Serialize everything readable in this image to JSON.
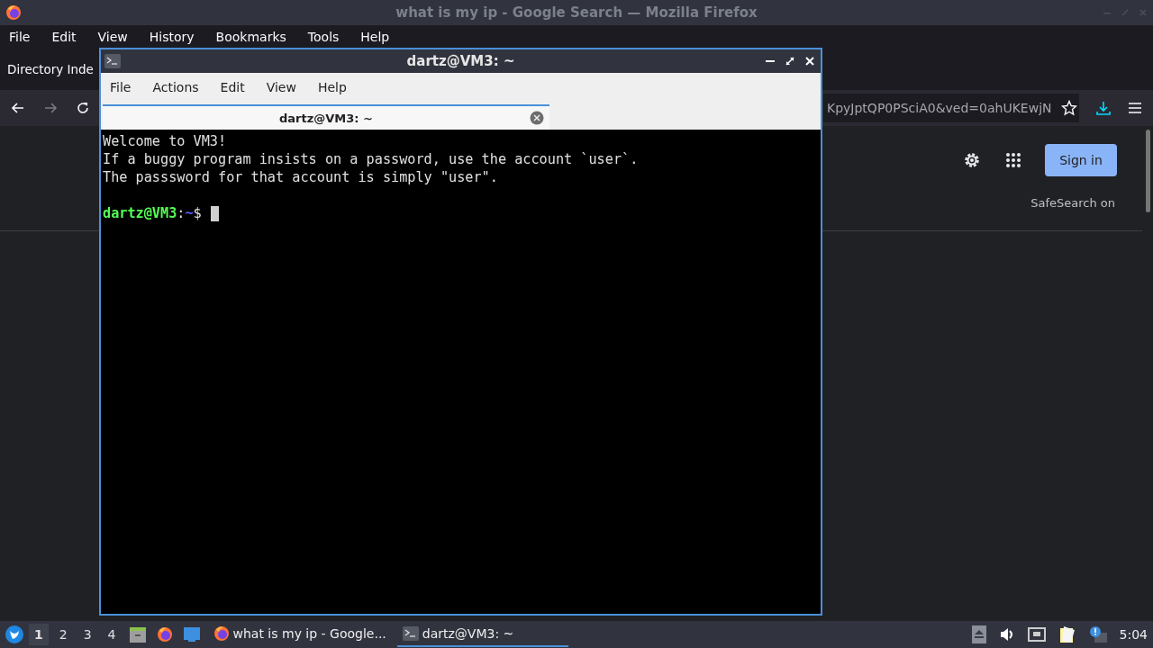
{
  "browser": {
    "title": "what is my ip - Google Search — Mozilla Firefox",
    "menu": [
      "File",
      "Edit",
      "View",
      "History",
      "Bookmarks",
      "Tools",
      "Help"
    ],
    "tab": {
      "label": "Directory Inde"
    },
    "url": {
      "value": "KpyJptQP0PSciA0&ved=0ahUKEwjN"
    },
    "page": {
      "sign_in": "Sign in",
      "safesearch": "SafeSearch on"
    }
  },
  "terminal": {
    "title": "dartz@VM3: ~",
    "menu": [
      "File",
      "Actions",
      "Edit",
      "View",
      "Help"
    ],
    "tabs": [
      {
        "label": "dartz@VM3: ~",
        "selected": true
      }
    ],
    "lines": [
      {
        "kind": "text",
        "text": "Welcome to VM3!"
      },
      {
        "kind": "text",
        "text": "If a buggy program insists on a password, use the account `user`."
      },
      {
        "kind": "text",
        "text": "The passsword for that account is simply \"user\"."
      },
      {
        "kind": "blank"
      },
      {
        "kind": "prompt",
        "user": "dartz@VM3",
        "sep": ":",
        "path": "~",
        "symbol": "$"
      }
    ]
  },
  "taskbar": {
    "workspaces": [
      {
        "label": "1",
        "selected": true
      },
      {
        "label": "2",
        "selected": false
      },
      {
        "label": "3",
        "selected": false
      },
      {
        "label": "4",
        "selected": false
      }
    ],
    "tasks": [
      {
        "kind": "browser",
        "label": "what is my ip - Google...",
        "selected": false
      },
      {
        "kind": "terminal",
        "label": "dartz@VM3: ~",
        "selected": true
      }
    ],
    "clock": "5:04"
  }
}
